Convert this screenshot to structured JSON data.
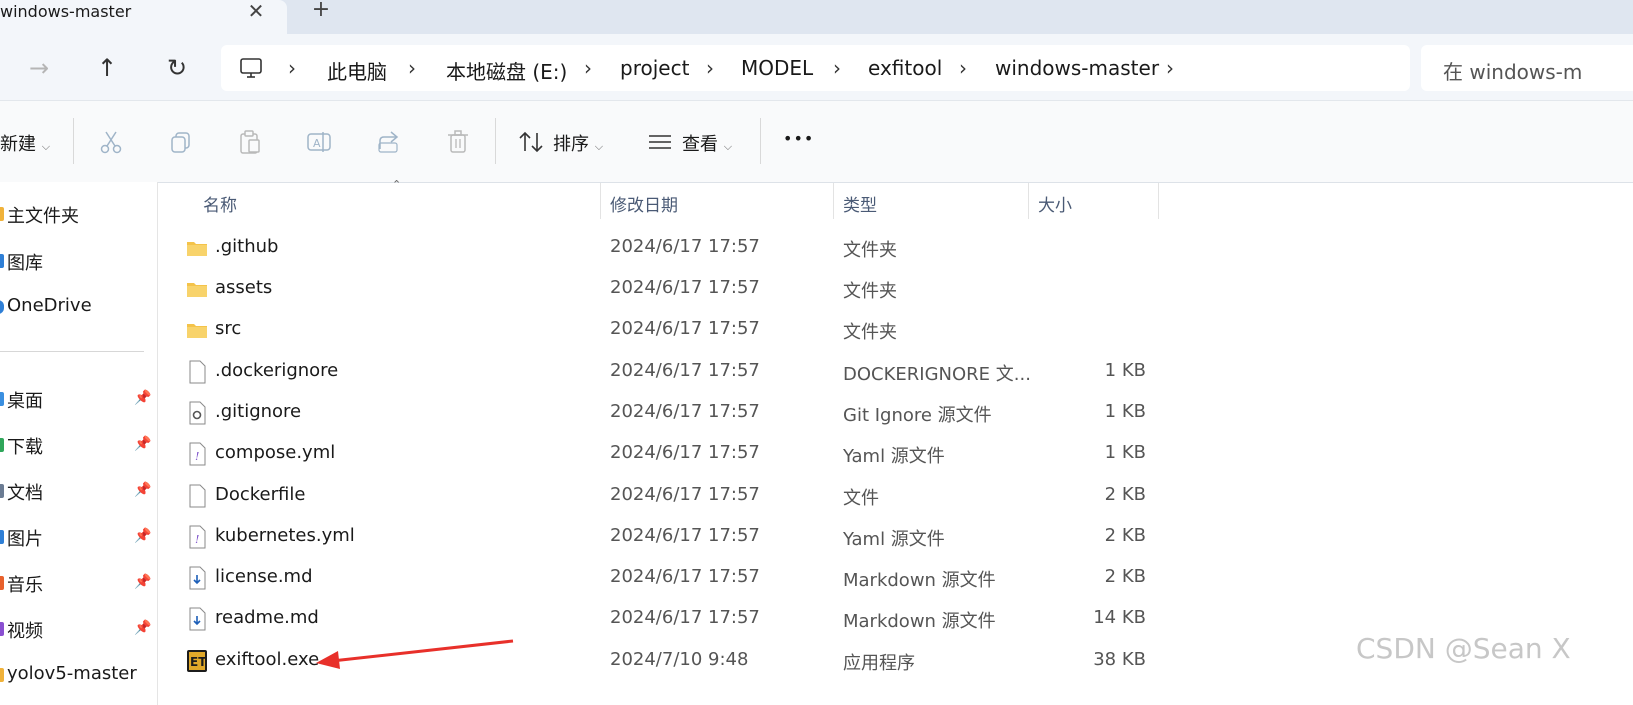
{
  "window": {
    "tab_title": "windows-master",
    "close_glyph": "✕",
    "new_tab_glyph": "+"
  },
  "nav": {
    "forward": "→",
    "up": "↑",
    "refresh": "↻"
  },
  "breadcrumb": [
    "此电脑",
    "本地磁盘 (E:)",
    "project",
    "MODEL",
    "exfitool",
    "windows-master"
  ],
  "search": {
    "placeholder": "在 windows-m"
  },
  "toolbar": {
    "new_label": "新建",
    "sort_label": "排序",
    "view_label": "查看",
    "more": "•••",
    "icons": [
      "cut-icon",
      "copy-icon",
      "paste-icon",
      "rename-icon",
      "share-icon",
      "delete-icon"
    ]
  },
  "sidebar": {
    "top_items": [
      "主文件夹",
      "图库",
      "OneDrive"
    ],
    "pinned_items": [
      "桌面",
      "下载",
      "文档",
      "图片",
      "音乐",
      "视频"
    ],
    "bottom_item": "yolov5-master"
  },
  "columns": {
    "name": "名称",
    "date": "修改日期",
    "type": "类型",
    "size": "大小"
  },
  "files": [
    {
      "name": ".github",
      "date": "2024/6/17 17:57",
      "type": "文件夹",
      "size": "",
      "icon": "folder-icon"
    },
    {
      "name": "assets",
      "date": "2024/6/17 17:57",
      "type": "文件夹",
      "size": "",
      "icon": "folder-icon"
    },
    {
      "name": "src",
      "date": "2024/6/17 17:57",
      "type": "文件夹",
      "size": "",
      "icon": "folder-icon"
    },
    {
      "name": ".dockerignore",
      "date": "2024/6/17 17:57",
      "type": "DOCKERIGNORE 文...",
      "size": "1 KB",
      "icon": "file-icon"
    },
    {
      "name": ".gitignore",
      "date": "2024/6/17 17:57",
      "type": "Git Ignore 源文件",
      "size": "1 KB",
      "icon": "settings-file-icon"
    },
    {
      "name": "compose.yml",
      "date": "2024/6/17 17:57",
      "type": "Yaml 源文件",
      "size": "1 KB",
      "icon": "yaml-file-icon"
    },
    {
      "name": "Dockerfile",
      "date": "2024/6/17 17:57",
      "type": "文件",
      "size": "2 KB",
      "icon": "file-icon"
    },
    {
      "name": "kubernetes.yml",
      "date": "2024/6/17 17:57",
      "type": "Yaml 源文件",
      "size": "2 KB",
      "icon": "yaml-file-icon"
    },
    {
      "name": "license.md",
      "date": "2024/6/17 17:57",
      "type": "Markdown 源文件",
      "size": "2 KB",
      "icon": "markdown-file-icon"
    },
    {
      "name": "readme.md",
      "date": "2024/6/17 17:57",
      "type": "Markdown 源文件",
      "size": "14 KB",
      "icon": "markdown-file-icon"
    },
    {
      "name": "exiftool.exe",
      "date": "2024/7/10 9:48",
      "type": "应用程序",
      "size": "38 KB",
      "icon": "exiftool-app-icon"
    }
  ],
  "watermark": "CSDN @Sean X",
  "colors": {
    "accent": "#0067c0",
    "folder": "#f4c34a",
    "arrow": "#e8302a"
  }
}
